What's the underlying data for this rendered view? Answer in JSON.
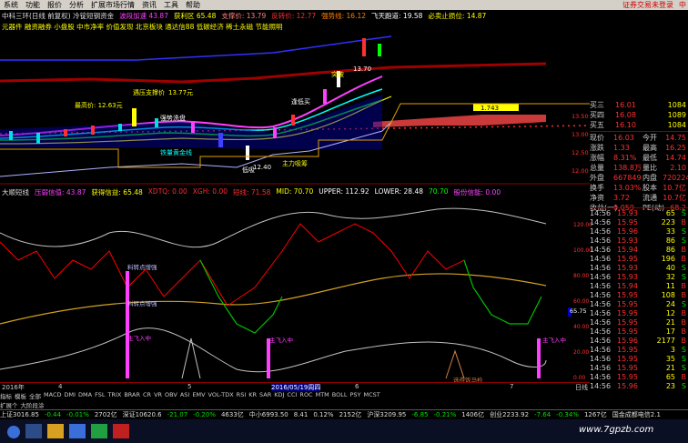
{
  "menu": {
    "items": [
      "系统",
      "功能",
      "报价",
      "分析",
      "扩展市场行情",
      "资讯",
      "工具",
      "帮助"
    ],
    "right_items": [
      "证券交易未登录",
      "中"
    ]
  },
  "header_line1": [
    "中科三环(日线 前复权) 冷锭短钢资金",
    "波段加速 43.87",
    "获利区 65.48",
    "支撑价: 13.79",
    "反转价: 12.77",
    "强势线: 16.12",
    "飞天跑道: 19.58",
    "必卖止损位: 14.87"
  ],
  "header_line2": "元器件 融资融券 小盘股 中市净率 价值发现 北京板块 通达信88 低碳经济 稀土永磁 节能照明",
  "price_labels": {
    "low_price": "最高价: 12.63元",
    "resist": "遇压支撑价",
    "resist_val": "13.77元",
    "breakout": "突破",
    "breakout_val": "13.70",
    "start": "逢低买",
    "cash_in": "强势洗盘",
    "low_buy": "低吸",
    "low_val": "12.40",
    "trend_gold": "铁量黄金线",
    "main_buy": "主力吸筹",
    "yellow_box": "1.743"
  },
  "price_axis": [
    "13.50",
    "13.00",
    "12.50",
    "12.00",
    "11.50"
  ],
  "indicator_header": [
    "大顺短线",
    "压弱信值: 43.87",
    "获得信益: 65.48",
    "XDTQ: 0.00",
    "XGH: 0.00",
    "短线: 71.58",
    "MID: 70.70",
    "UPPER: 112.92",
    "LOWER: 28.48",
    "70.70",
    "股份信能: 0.00"
  ],
  "indicator_labels": {
    "sig1": "料转点增强",
    "sig2": "料转点增强",
    "sig3": "主飞入中",
    "sig4": "主飞入中",
    "sig5": "主飞入中",
    "sig6": "选得饭马检",
    "val_box": "65.75"
  },
  "indicator_axis": [
    "120.00",
    "100.00",
    "80.00",
    "60.00",
    "40.00",
    "20.00",
    "0.00"
  ],
  "x_axis": {
    "left": "2016年",
    "m1": "4",
    "m2": "5",
    "date": "2016/05/19周四",
    "m3": "6",
    "m4": "7",
    "right": "日线"
  },
  "orderbook": [
    {
      "label": "买三",
      "price": "16.01",
      "vol": "1084"
    },
    {
      "label": "买四",
      "price": "16.08",
      "vol": "1089"
    },
    {
      "label": "买五",
      "price": "16.10",
      "vol": "1084"
    }
  ],
  "quote_rows": [
    {
      "l": "现价",
      "v": "16.03",
      "l2": "今开",
      "v2": "14.75"
    },
    {
      "l": "涨跌",
      "v": "1.33",
      "l2": "最高",
      "v2": "16.25"
    },
    {
      "l": "涨幅",
      "v": "8.31%",
      "l2": "最低",
      "v2": "14.74"
    },
    {
      "l": "总量",
      "v": "138.8万",
      "l2": "量比",
      "v2": "2.10"
    },
    {
      "l": "外盘",
      "v": "667849",
      "l2": "内盘",
      "v2": "720224"
    },
    {
      "l": "换手",
      "v": "13.03%",
      "l2": "股本",
      "v2": "10.7亿"
    },
    {
      "l": "净资",
      "v": "3.72",
      "l2": "流通",
      "v2": "10.7亿"
    },
    {
      "l": "收益(一)",
      "v": "0.059",
      "l2": "PE(动)",
      "v2": "68.2"
    }
  ],
  "trades": [
    {
      "t": "14:56",
      "p": "15.93",
      "v": "65",
      "s": "S"
    },
    {
      "t": "14:56",
      "p": "15.95",
      "v": "223",
      "s": "B"
    },
    {
      "t": "14:56",
      "p": "15.96",
      "v": "33",
      "s": "S"
    },
    {
      "t": "14:56",
      "p": "15.93",
      "v": "86",
      "s": "S"
    },
    {
      "t": "14:56",
      "p": "15.94",
      "v": "86",
      "s": "B"
    },
    {
      "t": "14:56",
      "p": "15.95",
      "v": "196",
      "s": "B"
    },
    {
      "t": "14:56",
      "p": "15.93",
      "v": "40",
      "s": "S"
    },
    {
      "t": "14:56",
      "p": "15.93",
      "v": "32",
      "s": "S"
    },
    {
      "t": "14:56",
      "p": "15.94",
      "v": "11",
      "s": "B"
    },
    {
      "t": "14:56",
      "p": "15.95",
      "v": "108",
      "s": "B"
    },
    {
      "t": "14:56",
      "p": "15.95",
      "v": "24",
      "s": "S"
    },
    {
      "t": "14:56",
      "p": "15.95",
      "v": "12",
      "s": "B"
    },
    {
      "t": "14:56",
      "p": "15.95",
      "v": "21",
      "s": "B"
    },
    {
      "t": "14:56",
      "p": "15.95",
      "v": "17",
      "s": "B"
    },
    {
      "t": "14:56",
      "p": "15.96",
      "v": "2177",
      "s": "B"
    },
    {
      "t": "14:56",
      "p": "15.95",
      "v": "3",
      "s": "S"
    },
    {
      "t": "14:56",
      "p": "15.95",
      "v": "35",
      "s": "S"
    },
    {
      "t": "14:56",
      "p": "15.95",
      "v": "21",
      "s": "S"
    },
    {
      "t": "14:56",
      "p": "15.95",
      "v": "65",
      "s": "B"
    },
    {
      "t": "14:56",
      "p": "15.96",
      "v": "23",
      "s": "S"
    },
    {
      "t": "15:00",
      "p": "16.03",
      "v": "7106",
      "s": "B"
    }
  ],
  "bottom_tabs": [
    "指标",
    "模板",
    "全部",
    "MACD",
    "DMI",
    "DMA",
    "FSL",
    "TRIX",
    "BRAR",
    "CR",
    "VR",
    "OBV",
    "ASI",
    "EMV",
    "VOL-TDX",
    "RSI",
    "KR",
    "SAR",
    "KDJ",
    "CCI",
    "ROC",
    "MTM",
    "BOLL",
    "PSY",
    "MCST"
  ],
  "bottom_tabs2": [
    "扩展个",
    "大阶段涂"
  ],
  "statusbar": [
    "上证3016.85",
    "-0.44",
    "-0.01%",
    "2702亿",
    "深证10620.6",
    "-21.07",
    "-0.20%",
    "4633亿",
    "中小6993.50",
    "8.41",
    "0.12%",
    "2152亿",
    "沪深3209.95",
    "-6.85",
    "-0.21%",
    "1406亿",
    "创业2233.92",
    "-7.64",
    "-0.34%",
    "1267亿",
    "国金成都电信2.1"
  ],
  "watermark": "www.7gpzb.com",
  "colors": {
    "up": "#ff3030",
    "down": "#00e000",
    "yellow": "#ffff00",
    "magenta": "#ff30ff"
  }
}
